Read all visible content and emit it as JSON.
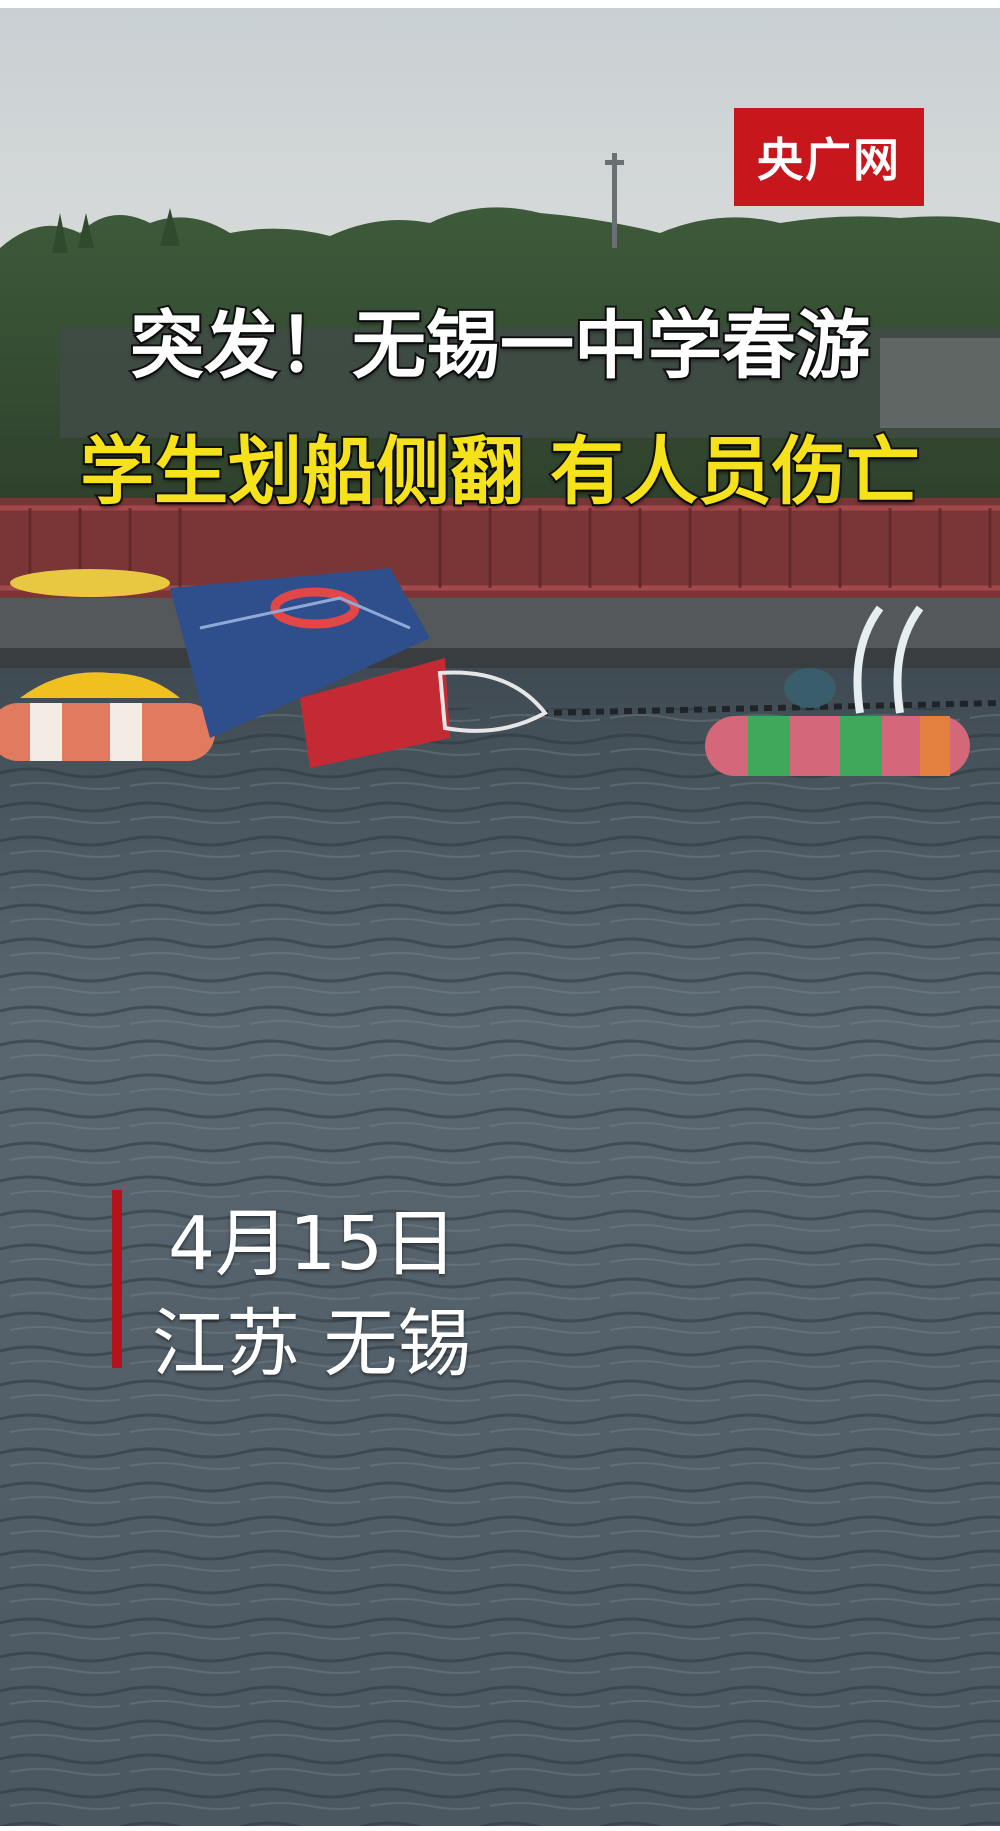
{
  "logo": {
    "text": "央广网",
    "color": "#c8161d"
  },
  "headline": {
    "line1": "突发！无锡一中学春游",
    "line2": "学生划船侧翻  有人员伤亡",
    "line1_color": "#ffffff",
    "line2_color": "#f5e21a"
  },
  "caption": {
    "date": "4月15日",
    "location": "江苏  无锡",
    "accent_color": "#b3141b"
  }
}
